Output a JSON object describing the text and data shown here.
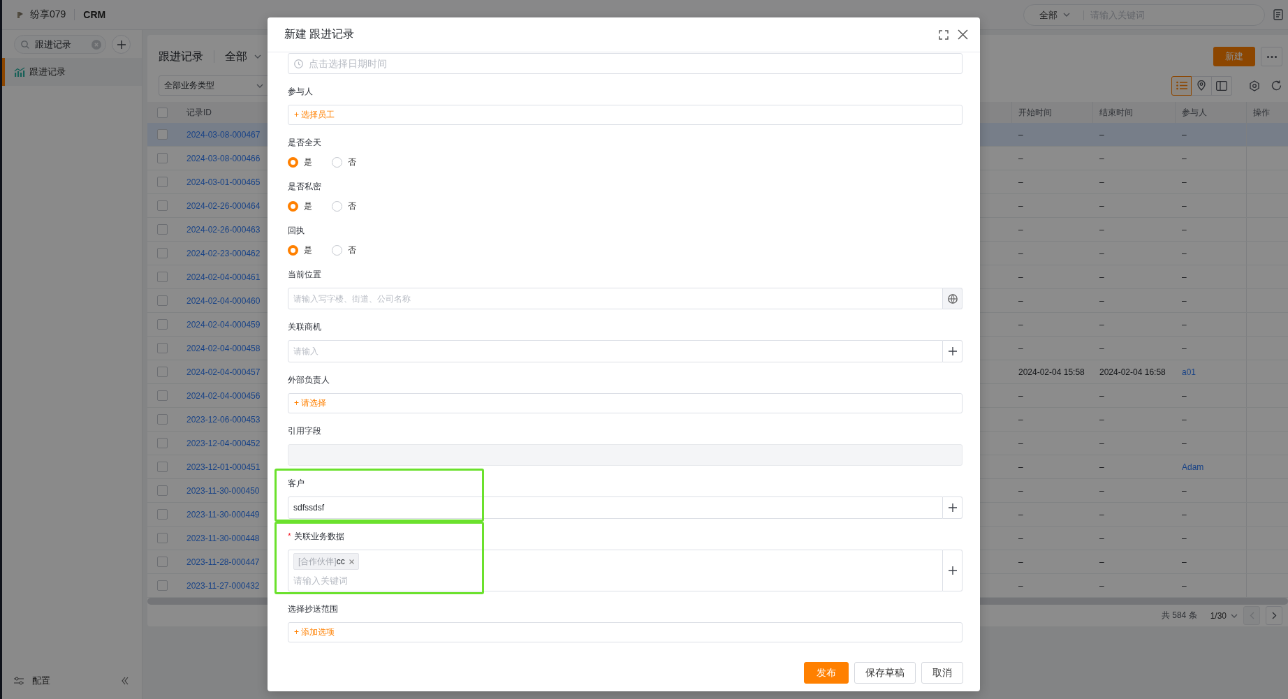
{
  "top_bar": {
    "org": "纷享079",
    "app": "CRM",
    "search": {
      "scope": "全部",
      "placeholder": "请输入关键词"
    }
  },
  "sidebar": {
    "search": {
      "value": "跟进记录"
    },
    "items": [
      {
        "label": "跟进记录",
        "selected": true
      }
    ],
    "footer": {
      "label": "配置"
    }
  },
  "list_view": {
    "title": "跟进记录",
    "scope": "全部",
    "filter": "全部业务类型",
    "new_button": "新建",
    "view_modes": [
      {
        "kind": "list",
        "selected": true
      },
      {
        "kind": "map",
        "selected": false
      },
      {
        "kind": "panel",
        "selected": false
      }
    ],
    "table": {
      "header_checked": false,
      "columns": [
        "记录ID",
        "开始时间",
        "结束时间",
        "参与人",
        "操作"
      ],
      "rows": [
        {
          "record_id": "2024-03-08-000467",
          "start_time": "–",
          "end_time": "–",
          "participant": "–",
          "participant_link": false,
          "checked": false,
          "hovered": true
        },
        {
          "record_id": "2024-03-08-000466",
          "start_time": "–",
          "end_time": "–",
          "participant": "–",
          "participant_link": false,
          "checked": false,
          "hovered": false
        },
        {
          "record_id": "2024-03-01-000465",
          "start_time": "–",
          "end_time": "–",
          "participant": "–",
          "participant_link": false,
          "checked": false,
          "hovered": false
        },
        {
          "record_id": "2024-02-26-000464",
          "start_time": "–",
          "end_time": "–",
          "participant": "–",
          "participant_link": false,
          "checked": false,
          "hovered": false
        },
        {
          "record_id": "2024-02-26-000463",
          "start_time": "–",
          "end_time": "–",
          "participant": "–",
          "participant_link": false,
          "checked": false,
          "hovered": false
        },
        {
          "record_id": "2024-02-23-000462",
          "start_time": "–",
          "end_time": "–",
          "participant": "–",
          "participant_link": false,
          "checked": false,
          "hovered": false
        },
        {
          "record_id": "2024-02-04-000461",
          "start_time": "–",
          "end_time": "–",
          "participant": "–",
          "participant_link": false,
          "checked": false,
          "hovered": false
        },
        {
          "record_id": "2024-02-04-000460",
          "start_time": "–",
          "end_time": "–",
          "participant": "–",
          "participant_link": false,
          "checked": false,
          "hovered": false
        },
        {
          "record_id": "2024-02-04-000459",
          "start_time": "–",
          "end_time": "–",
          "participant": "–",
          "participant_link": false,
          "checked": false,
          "hovered": false
        },
        {
          "record_id": "2024-02-04-000458",
          "start_time": "–",
          "end_time": "–",
          "participant": "–",
          "participant_link": false,
          "checked": false,
          "hovered": false
        },
        {
          "record_id": "2024-02-04-000457",
          "start_time": "2024-02-04 15:58",
          "end_time": "2024-02-04 16:58",
          "participant": "a01",
          "participant_link": true,
          "checked": false,
          "hovered": false
        },
        {
          "record_id": "2024-02-04-000456",
          "start_time": "–",
          "end_time": "–",
          "participant": "–",
          "participant_link": false,
          "checked": false,
          "hovered": false
        },
        {
          "record_id": "2023-12-06-000453",
          "start_time": "–",
          "end_time": "–",
          "participant": "–",
          "participant_link": false,
          "checked": false,
          "hovered": false
        },
        {
          "record_id": "2023-12-04-000452",
          "start_time": "–",
          "end_time": "–",
          "participant": "–",
          "participant_link": false,
          "checked": false,
          "hovered": false
        },
        {
          "record_id": "2023-12-01-000451",
          "start_time": "–",
          "end_time": "–",
          "participant": "Adam",
          "participant_link": true,
          "checked": false,
          "hovered": false
        },
        {
          "record_id": "2023-11-30-000450",
          "start_time": "–",
          "end_time": "–",
          "participant": "–",
          "participant_link": false,
          "checked": false,
          "hovered": false
        },
        {
          "record_id": "2023-11-30-000449",
          "start_time": "–",
          "end_time": "–",
          "participant": "–",
          "participant_link": false,
          "checked": false,
          "hovered": false
        },
        {
          "record_id": "2023-11-30-000448",
          "start_time": "–",
          "end_time": "–",
          "participant": "–",
          "participant_link": false,
          "checked": false,
          "hovered": false
        },
        {
          "record_id": "2023-11-28-000447",
          "start_time": "–",
          "end_time": "–",
          "participant": "–",
          "participant_link": false,
          "checked": false,
          "hovered": false
        },
        {
          "record_id": "2023-11-27-000432",
          "start_time": "–",
          "end_time": "–",
          "participant": "–",
          "participant_link": false,
          "checked": false,
          "hovered": false
        }
      ]
    },
    "pagination": {
      "total": "共 584 条",
      "page": "1/30",
      "prev_disabled": true,
      "next_disabled": false
    }
  },
  "modal": {
    "title": "新建 跟进记录",
    "fields": [
      {
        "kind": "datetime",
        "placeholder": "点击选择日期时间",
        "highlighted": false
      },
      {
        "kind": "picker",
        "label": "参与人",
        "action": "+ 选择员工",
        "highlighted": false
      },
      {
        "kind": "radio",
        "label": "是否全天",
        "options": [
          {
            "label": "是",
            "selected": true
          },
          {
            "label": "否",
            "selected": false
          }
        ],
        "highlighted": false
      },
      {
        "kind": "radio",
        "label": "是否私密",
        "options": [
          {
            "label": "是",
            "selected": true
          },
          {
            "label": "否",
            "selected": false
          }
        ],
        "highlighted": false
      },
      {
        "kind": "radio",
        "label": "回执",
        "options": [
          {
            "label": "是",
            "selected": true
          },
          {
            "label": "否",
            "selected": false
          }
        ],
        "highlighted": false
      },
      {
        "kind": "location",
        "label": "当前位置",
        "placeholder": "请输入写字楼、街道、公司名称",
        "highlighted": false
      },
      {
        "kind": "lookup",
        "label": "关联商机",
        "placeholder": "请输入",
        "highlighted": false
      },
      {
        "kind": "picker",
        "label": "外部负责人",
        "action": "+ 请选择",
        "highlighted": false
      },
      {
        "kind": "readonly",
        "label": "引用字段",
        "highlighted": false
      },
      {
        "kind": "lookup",
        "label": "客户",
        "value": "sdfssdsf",
        "highlighted": true
      },
      {
        "kind": "tags",
        "label": "关联业务数据",
        "required_mark": "*",
        "tags": [
          {
            "type": "[合作伙伴]",
            "name": "cc"
          }
        ],
        "placeholder": "请输入关键词",
        "highlighted": true
      },
      {
        "kind": "picker",
        "label": "选择抄送范围",
        "action": "+ 添加选项",
        "highlighted": false
      }
    ],
    "buttons": [
      {
        "label": "发布",
        "kind": "primary"
      },
      {
        "label": "保存草稿",
        "kind": "default"
      },
      {
        "label": "取消",
        "kind": "default"
      }
    ]
  }
}
